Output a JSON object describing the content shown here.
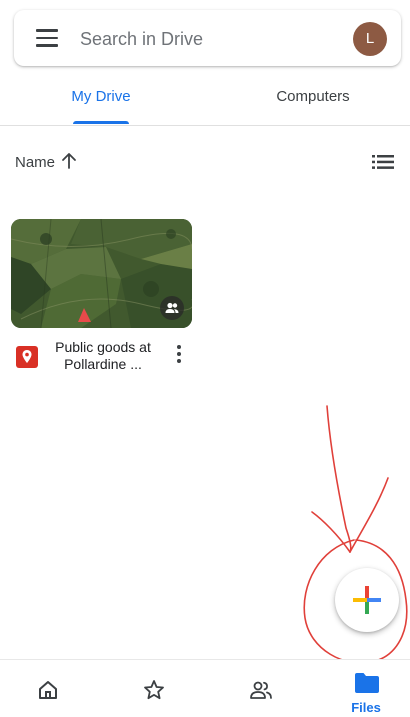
{
  "search": {
    "placeholder": "Search in Drive",
    "avatar_initial": "L"
  },
  "tabs": [
    {
      "label": "My Drive",
      "selected": true
    },
    {
      "label": "Computers",
      "selected": false
    }
  ],
  "sort": {
    "label": "Name",
    "direction": "ascending"
  },
  "files": [
    {
      "name": "Public goods at Pollardine ...",
      "type_icon": "map-pin-icon",
      "shared": true
    }
  ],
  "fab": {
    "icon": "plus-icon"
  },
  "bottom_nav": {
    "items": [
      {
        "icon": "home-icon",
        "label": "",
        "active": false
      },
      {
        "icon": "star-icon",
        "label": "",
        "active": false
      },
      {
        "icon": "shared-people-icon",
        "label": "",
        "active": false
      },
      {
        "icon": "folder-icon",
        "label": "Files",
        "active": true
      }
    ]
  },
  "colors": {
    "accent": "#1a73e8",
    "annotation": "#e0403a",
    "avatar": "#8d5a43"
  }
}
